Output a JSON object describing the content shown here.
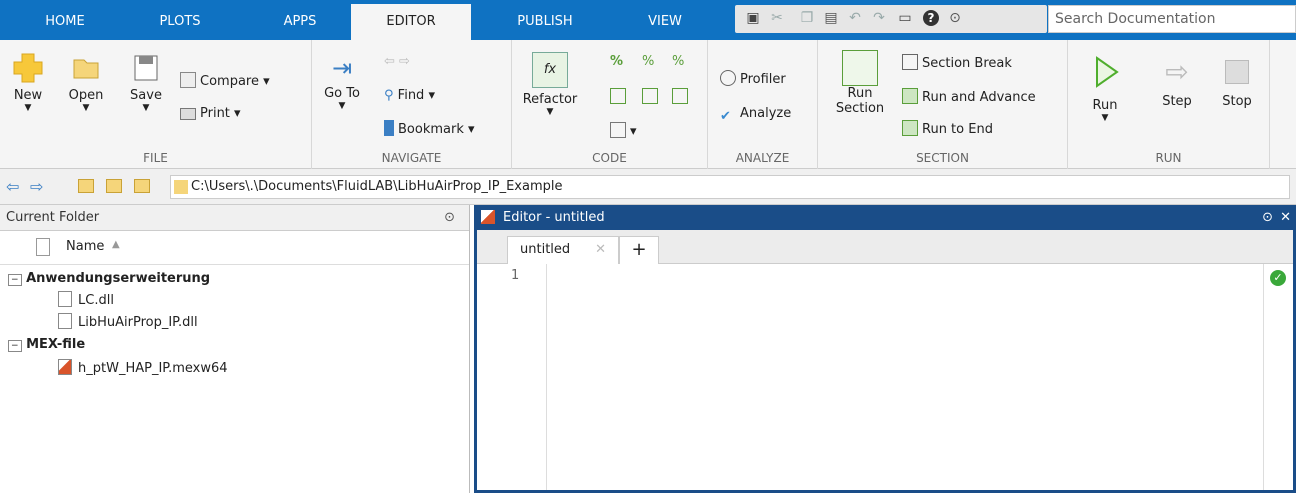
{
  "tabs": [
    "HOME",
    "PLOTS",
    "APPS",
    "EDITOR",
    "PUBLISH",
    "VIEW"
  ],
  "search_placeholder": "Search Documentation",
  "file": {
    "new": "New",
    "open": "Open",
    "save": "Save",
    "compare": "Compare",
    "print": "Print",
    "label": "FILE"
  },
  "navigate": {
    "goto": "Go To",
    "find": "Find",
    "bookmark": "Bookmark",
    "label": "NAVIGATE"
  },
  "code": {
    "refactor": "Refactor",
    "label": "CODE"
  },
  "analyze": {
    "profiler": "Profiler",
    "analyze": "Analyze",
    "label": "ANALYZE"
  },
  "section": {
    "run_section_1": "Run",
    "run_section_2": "Section",
    "section_break": "Section Break",
    "run_advance": "Run and Advance",
    "run_end": "Run to End",
    "label": "SECTION"
  },
  "run": {
    "run": "Run",
    "step": "Step",
    "stop": "Stop",
    "label": "RUN"
  },
  "address": "C:\\Users\\.\\Documents\\FluidLAB\\LibHuAirProp_IP_Example",
  "current_folder": {
    "title": "Current Folder",
    "name_col": "Name"
  },
  "groups": [
    {
      "name": "Anwendungserweiterung",
      "files": [
        "LC.dll",
        "LibHuAirProp_IP.dll"
      ]
    },
    {
      "name": "MEX-file",
      "files": [
        "h_ptW_HAP_IP.mexw64"
      ]
    }
  ],
  "editor": {
    "title": "Editor - untitled",
    "tab": "untitled",
    "line": "1"
  },
  "colors": {
    "tabbar": "#0f72c2",
    "editor_header": "#1a4d88",
    "ok": "#3aa83a"
  }
}
